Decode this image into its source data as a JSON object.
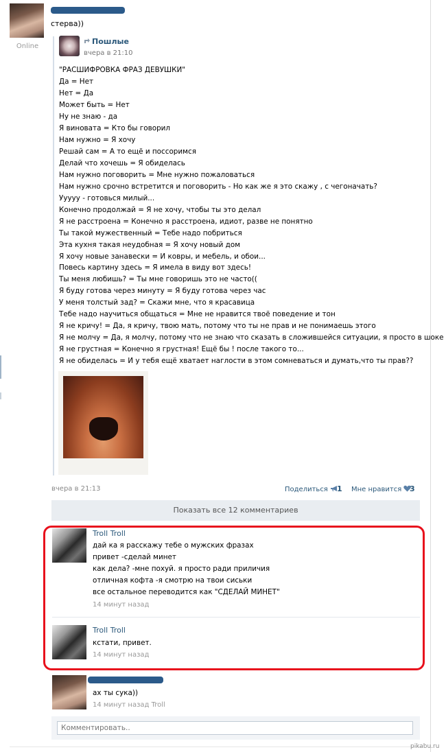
{
  "post": {
    "status": "Online",
    "text": "стерва))"
  },
  "repost": {
    "icon": "repost-arrow-icon",
    "author": "Пошлые",
    "date": "вчера в 21:10",
    "lines": [
      "\"РАСШИФРОВКА ФРАЗ ДЕВУШКИ\"",
      "Да = Нет",
      "Нет = Да",
      "Может быть = Нет",
      "Ну не знаю - да",
      "Я виновата = Кто бы говорил",
      "Нам нужно = Я хочу",
      "Решай сам = А то ещё и поссоримся",
      "Делай что хочешь = Я обиделась",
      "Нам нужно поговорить = Мне нужно пожаловаться",
      "Нам нужно срочно встретится и поговорить - Но как же я это скажу , с чегоначать?",
      "Ууууу - готовься милый...",
      "Конечно продолжай = Я не хочу, чтобы ты это делал",
      "Я не расстроена = Конечно я расстроена, идиот, разве не понятно",
      "Ты такой мужественный = Тебе надо побриться",
      "Эта кухня такая неудобная = Я хочу новый дом",
      "Я хочу новые занавески = И ковры, и мебель, и обои...",
      "Повесь картину здесь = Я имела в виду вот здесь!",
      "Ты меня любишь? = Ты мне говоришь это не часто((",
      "Я буду готова через минуту = Я буду готова через час",
      "У меня толстый зад? = Скажи мне, что я красавица",
      "Тебе надо научиться общаться = Мне не нравится твоё поведение и тон",
      "Я не кричу! = Да, я кричу, твою мать, потому что ты не прав и не понимаешь этого",
      "Я не молчу = Да, я молчу, потому что не знаю что сказать в сложившейся ситуации, я просто в шоке",
      "Я не грустная = Конечно я грустная! Ещё бы ! после такого то...",
      "Я не обиделась = И у тебя ещё хватает наглости в этом сомневаться и думать,что ты прав??"
    ]
  },
  "footer": {
    "date": "вчера в 21:13",
    "share_label": "Поделиться",
    "share_icon": "megaphone-icon",
    "share_count": "1",
    "like_label": "Мне нравится",
    "like_icon": "heart-icon",
    "like_count": "3"
  },
  "show_all": "Показать все 12 комментариев",
  "comments": [
    {
      "author": "Troll Troll",
      "lines": [
        "дай ка я расскажу тебе о мужских фразах",
        "привет -сделай минет",
        "как дела? -мне похуй. я просто ради приличия",
        "отличная кофта -я смотрю на твои сиськи",
        "все остальное переводится как \"СДЕЛАЙ МИНЕТ\""
      ],
      "time": "14 минут назад"
    },
    {
      "author": "Troll Troll",
      "lines": [
        "кстати, привет."
      ],
      "time": "14 минут назад"
    },
    {
      "author": "",
      "lines": [
        "ах ты сука))"
      ],
      "time": "14 минут назад Troll"
    }
  ],
  "comment_input": {
    "placeholder": "Комментировать.."
  },
  "watermark": "pikabu.ru",
  "colors": {
    "link": "#2b587a",
    "highlight_border": "#e8101c"
  }
}
